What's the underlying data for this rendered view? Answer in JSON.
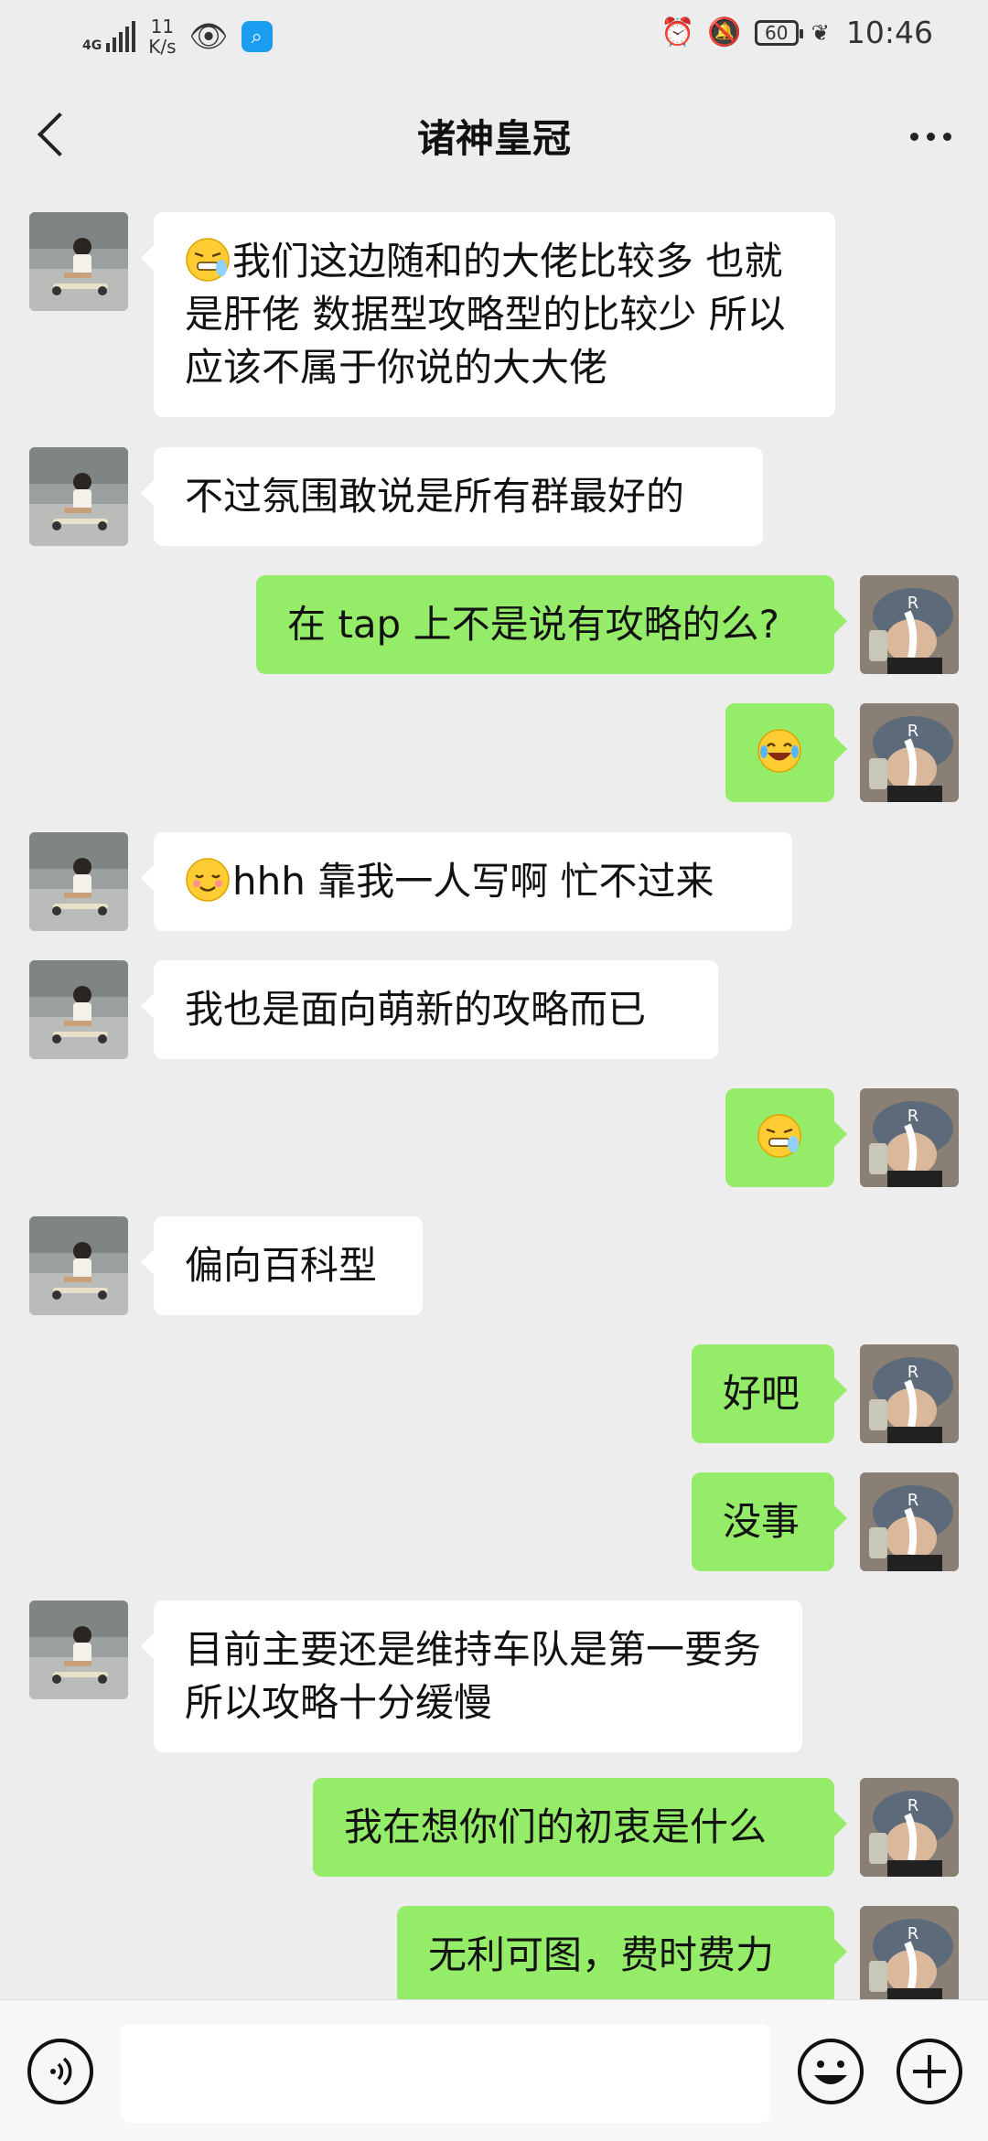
{
  "status_bar": {
    "network": "4G",
    "speed_value": "11",
    "speed_unit": "K/s",
    "battery": "60",
    "time": "10:46"
  },
  "header": {
    "title": "诸神皇冠"
  },
  "messages": [
    {
      "side": "left",
      "emoji": "grimace",
      "text": "我们这边随和的大佬比较多 也就是肝佬 数据型攻略型的比较少 所以应该不属于你说的大大佬"
    },
    {
      "side": "left",
      "emoji": "",
      "text": "不过氛围敢说是所有群最好的"
    },
    {
      "side": "right",
      "emoji": "",
      "text": "在 tap 上不是说有攻略的么?"
    },
    {
      "side": "right",
      "emoji": "laugh-tears",
      "text": ""
    },
    {
      "side": "left",
      "emoji": "blush",
      "text": "hhh 靠我一人写啊 忙不过来"
    },
    {
      "side": "left",
      "emoji": "",
      "text": "我也是面向萌新的攻略而已"
    },
    {
      "side": "right",
      "emoji": "grimace",
      "text": ""
    },
    {
      "side": "left",
      "emoji": "",
      "text": "偏向百科型"
    },
    {
      "side": "right",
      "emoji": "",
      "text": "好吧"
    },
    {
      "side": "right",
      "emoji": "",
      "text": "没事"
    },
    {
      "side": "left",
      "emoji": "",
      "text": "目前主要还是维持车队是第一要务 所以攻略十分缓慢"
    },
    {
      "side": "right",
      "emoji": "",
      "text": "我在想你们的初衷是什么"
    },
    {
      "side": "right",
      "emoji": "",
      "text": "无利可图，费时费力"
    }
  ],
  "colors": {
    "background": "#ededed",
    "bubble_self": "#95ec69",
    "bubble_other": "#ffffff"
  },
  "icons": {
    "back": "chevron-left-icon",
    "more": "more-dots-icon",
    "voice": "voice-icon",
    "emoji": "emoji-icon",
    "plus": "plus-icon"
  }
}
